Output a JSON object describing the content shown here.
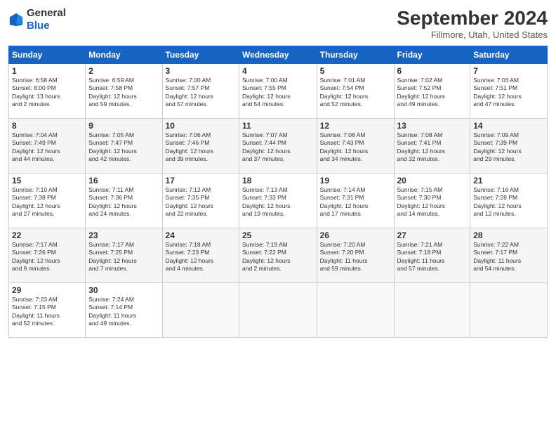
{
  "header": {
    "logo_line1": "General",
    "logo_line2": "Blue",
    "month_title": "September 2024",
    "subtitle": "Fillmore, Utah, United States"
  },
  "days_of_week": [
    "Sunday",
    "Monday",
    "Tuesday",
    "Wednesday",
    "Thursday",
    "Friday",
    "Saturday"
  ],
  "weeks": [
    [
      {
        "day": "1",
        "info": "Sunrise: 6:58 AM\nSunset: 8:00 PM\nDaylight: 13 hours\nand 2 minutes."
      },
      {
        "day": "2",
        "info": "Sunrise: 6:59 AM\nSunset: 7:58 PM\nDaylight: 12 hours\nand 59 minutes."
      },
      {
        "day": "3",
        "info": "Sunrise: 7:00 AM\nSunset: 7:57 PM\nDaylight: 12 hours\nand 57 minutes."
      },
      {
        "day": "4",
        "info": "Sunrise: 7:00 AM\nSunset: 7:55 PM\nDaylight: 12 hours\nand 54 minutes."
      },
      {
        "day": "5",
        "info": "Sunrise: 7:01 AM\nSunset: 7:54 PM\nDaylight: 12 hours\nand 52 minutes."
      },
      {
        "day": "6",
        "info": "Sunrise: 7:02 AM\nSunset: 7:52 PM\nDaylight: 12 hours\nand 49 minutes."
      },
      {
        "day": "7",
        "info": "Sunrise: 7:03 AM\nSunset: 7:51 PM\nDaylight: 12 hours\nand 47 minutes."
      }
    ],
    [
      {
        "day": "8",
        "info": "Sunrise: 7:04 AM\nSunset: 7:49 PM\nDaylight: 12 hours\nand 44 minutes."
      },
      {
        "day": "9",
        "info": "Sunrise: 7:05 AM\nSunset: 7:47 PM\nDaylight: 12 hours\nand 42 minutes."
      },
      {
        "day": "10",
        "info": "Sunrise: 7:06 AM\nSunset: 7:46 PM\nDaylight: 12 hours\nand 39 minutes."
      },
      {
        "day": "11",
        "info": "Sunrise: 7:07 AM\nSunset: 7:44 PM\nDaylight: 12 hours\nand 37 minutes."
      },
      {
        "day": "12",
        "info": "Sunrise: 7:08 AM\nSunset: 7:43 PM\nDaylight: 12 hours\nand 34 minutes."
      },
      {
        "day": "13",
        "info": "Sunrise: 7:08 AM\nSunset: 7:41 PM\nDaylight: 12 hours\nand 32 minutes."
      },
      {
        "day": "14",
        "info": "Sunrise: 7:09 AM\nSunset: 7:39 PM\nDaylight: 12 hours\nand 29 minutes."
      }
    ],
    [
      {
        "day": "15",
        "info": "Sunrise: 7:10 AM\nSunset: 7:38 PM\nDaylight: 12 hours\nand 27 minutes."
      },
      {
        "day": "16",
        "info": "Sunrise: 7:11 AM\nSunset: 7:36 PM\nDaylight: 12 hours\nand 24 minutes."
      },
      {
        "day": "17",
        "info": "Sunrise: 7:12 AM\nSunset: 7:35 PM\nDaylight: 12 hours\nand 22 minutes."
      },
      {
        "day": "18",
        "info": "Sunrise: 7:13 AM\nSunset: 7:33 PM\nDaylight: 12 hours\nand 19 minutes."
      },
      {
        "day": "19",
        "info": "Sunrise: 7:14 AM\nSunset: 7:31 PM\nDaylight: 12 hours\nand 17 minutes."
      },
      {
        "day": "20",
        "info": "Sunrise: 7:15 AM\nSunset: 7:30 PM\nDaylight: 12 hours\nand 14 minutes."
      },
      {
        "day": "21",
        "info": "Sunrise: 7:16 AM\nSunset: 7:28 PM\nDaylight: 12 hours\nand 12 minutes."
      }
    ],
    [
      {
        "day": "22",
        "info": "Sunrise: 7:17 AM\nSunset: 7:26 PM\nDaylight: 12 hours\nand 9 minutes."
      },
      {
        "day": "23",
        "info": "Sunrise: 7:17 AM\nSunset: 7:25 PM\nDaylight: 12 hours\nand 7 minutes."
      },
      {
        "day": "24",
        "info": "Sunrise: 7:18 AM\nSunset: 7:23 PM\nDaylight: 12 hours\nand 4 minutes."
      },
      {
        "day": "25",
        "info": "Sunrise: 7:19 AM\nSunset: 7:22 PM\nDaylight: 12 hours\nand 2 minutes."
      },
      {
        "day": "26",
        "info": "Sunrise: 7:20 AM\nSunset: 7:20 PM\nDaylight: 11 hours\nand 59 minutes."
      },
      {
        "day": "27",
        "info": "Sunrise: 7:21 AM\nSunset: 7:18 PM\nDaylight: 11 hours\nand 57 minutes."
      },
      {
        "day": "28",
        "info": "Sunrise: 7:22 AM\nSunset: 7:17 PM\nDaylight: 11 hours\nand 54 minutes."
      }
    ],
    [
      {
        "day": "29",
        "info": "Sunrise: 7:23 AM\nSunset: 7:15 PM\nDaylight: 11 hours\nand 52 minutes."
      },
      {
        "day": "30",
        "info": "Sunrise: 7:24 AM\nSunset: 7:14 PM\nDaylight: 11 hours\nand 49 minutes."
      },
      {
        "day": "",
        "info": ""
      },
      {
        "day": "",
        "info": ""
      },
      {
        "day": "",
        "info": ""
      },
      {
        "day": "",
        "info": ""
      },
      {
        "day": "",
        "info": ""
      }
    ]
  ]
}
